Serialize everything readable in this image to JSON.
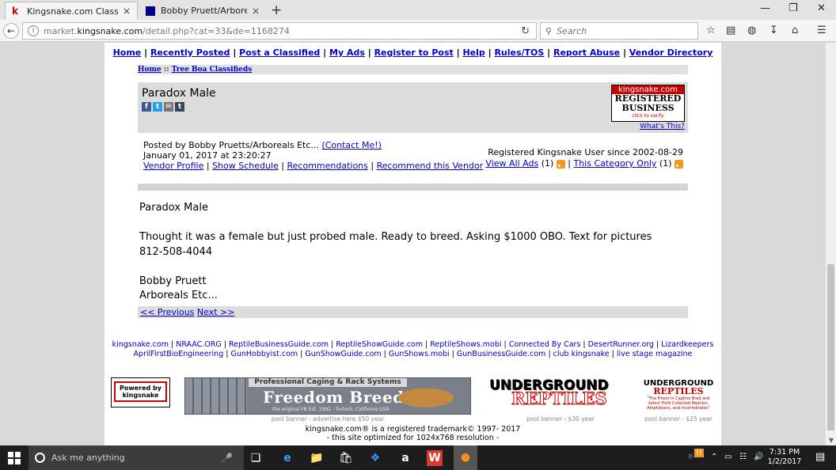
{
  "browser": {
    "tabs": [
      {
        "title": "Kingsnake.com Classifieds...",
        "close": "×",
        "favicon_color": "#c00"
      },
      {
        "title": "Bobby Pruett/Arboreals Et...",
        "close": "×",
        "favicon_color": "#00008b"
      }
    ],
    "new_tab": "+",
    "url_prefix": "market.",
    "url_domain": "kingsnake.com",
    "url_path": "/detail.php?cat=33&de=1168274",
    "search_placeholder": "Search"
  },
  "site": {
    "top_nav": [
      "Home",
      "Recently Posted",
      "Post a Classified",
      "My Ads",
      "Register to Post",
      "Help",
      "Rules/TOS",
      "Report Abuse",
      "Vendor Directory"
    ],
    "breadcrumb": {
      "home": "Home",
      "sep": " :: ",
      "category": "Tree Boa Classifieds"
    }
  },
  "ad": {
    "title": "Paradox Male",
    "share_icons": [
      "f",
      "t",
      "✉",
      "t"
    ],
    "badge": {
      "top": "kingsnake.com",
      "line1": "REGISTERED",
      "line2": "BUSINESS",
      "small": "click to verify"
    },
    "whats_this": "What's This?",
    "posted_by": "Posted by Bobby Pruetts/Arboreals Etc...",
    "contact": "(Contact Me!)",
    "date": "January 01, 2017 at 23:20:27",
    "vendor_links": [
      "Vendor Profile",
      "Show Schedule",
      "Recommendations",
      "Recommend this Vendor"
    ],
    "registered_since": "Registered Kingsnake User since 2002-08-29",
    "view_all": "View All Ads",
    "view_all_count": "(1)",
    "this_category": "This Category Only",
    "this_category_count": "(1)",
    "body_lines": [
      "Paradox Male",
      "",
      "Thought it was a female but just probed male. Ready to breed. Asking $1000 OBO. Text for pictures",
      "812-508-4044",
      "",
      "Bobby Pruett",
      "Arboreals Etc..."
    ],
    "previous": "<< Previous",
    "next": "Next >>"
  },
  "footer": {
    "links_line1": [
      "kingsnake.com",
      "NRAAC.ORG",
      "ReptileBusinessGuide.com",
      "ReptileShowGuide.com",
      "ReptileShows.mobi",
      "Connected By Cars",
      "DesertRunner.org",
      "Lizardkeepers"
    ],
    "links_line2": [
      "AprilFirstBioEngineering",
      "GunHobbyist.com",
      "GunShowGuide.com",
      "GunShows.mobi",
      "GunBusinessGuide.com",
      "club kingsnake",
      "live stage magazine"
    ],
    "powered_by": "Powered by kingsnake",
    "freedom_tagline": "Professional Caging & Rack Systems",
    "freedom_brand": "Freedom Breeder",
    "freedom_est": "the original  FB  Est. 1992 - Turlock, California USA",
    "banner1_caption": "pool banner - advertise here $50 year",
    "ug_top": "UNDERGROUND",
    "ug_bottom": "REPTILES",
    "banner2_caption": "pool banner - $30 year",
    "ug2_tagline": "\"The Finest in Captive Bred and Select Field Collected Reptiles, Amphibians, and Invertebrates\"",
    "banner3_caption": "pool banner - $25 year",
    "copyright1": "kingsnake.com® is a registered trademark© 1997- 2017",
    "copyright2": "- this site optimized for 1024x768 resolution -"
  },
  "taskbar": {
    "search_placeholder": "Ask me anything",
    "time": "7:31 PM",
    "date": "1/2/2017"
  }
}
